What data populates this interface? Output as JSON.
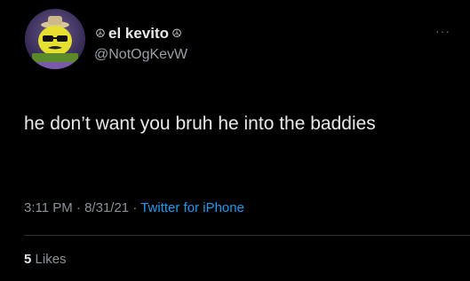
{
  "user": {
    "display_name": "el kevito",
    "name_prefix_emoji": "☮",
    "name_suffix_emoji": "☮",
    "handle": "@NotOgKevW",
    "avatar_icon": "avatar-icon",
    "avatar_badge_text": "el kevito"
  },
  "tweet": {
    "text": "he don’t want you bruh he into the baddies",
    "time": "3:11 PM",
    "separator": "·",
    "date": "8/31/21",
    "source": "Twitter for iPhone"
  },
  "stats": {
    "likes_count": "5",
    "likes_label": "Likes"
  },
  "menu": {
    "more_icon": "ellipsis-icon",
    "more_glyph": "···"
  },
  "colors": {
    "background": "#000000",
    "text": "#e7e9ea",
    "secondary": "#8b9299",
    "link": "#1d9bf0"
  }
}
